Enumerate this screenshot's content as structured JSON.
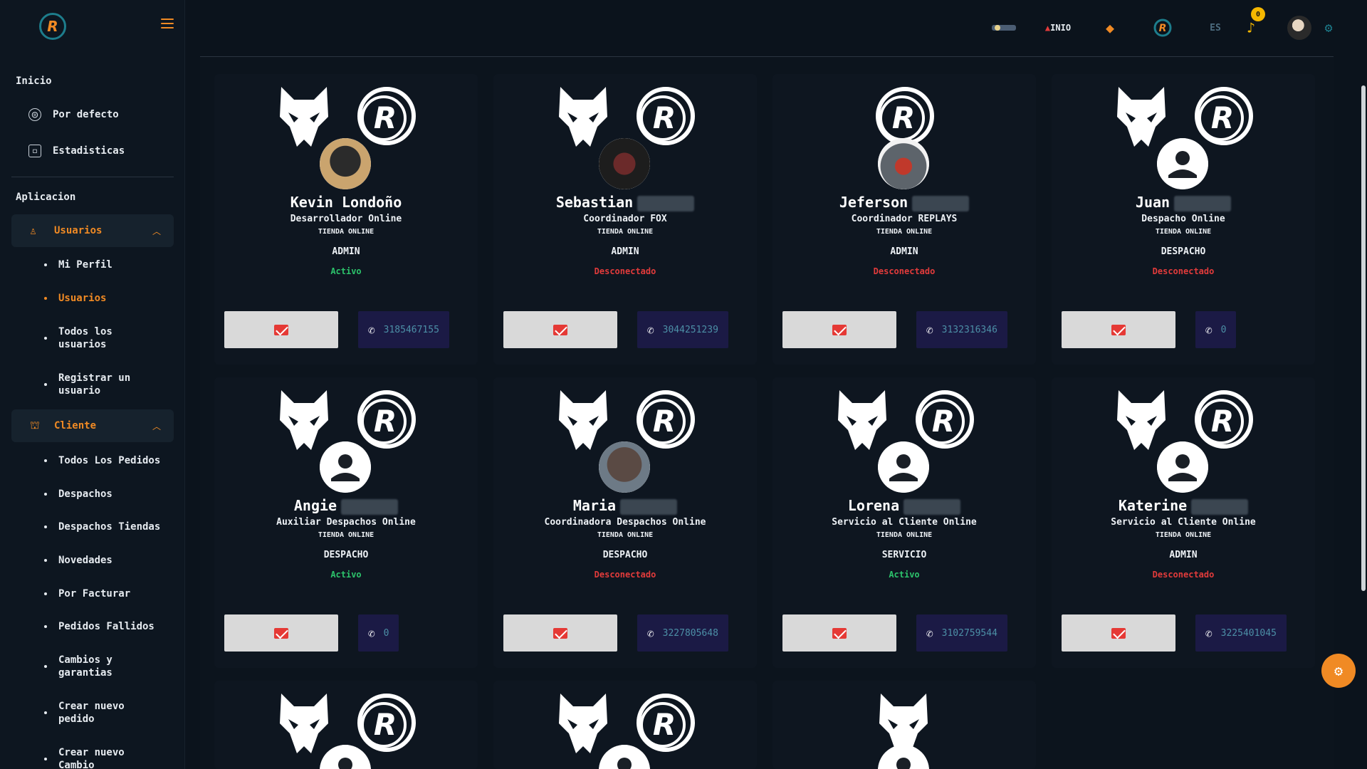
{
  "sidebar": {
    "heading_inicio": "Inicio",
    "link_default": "Por defecto",
    "link_stats": "Estadisticas",
    "heading_app": "Aplicacion",
    "group_users": "Usuarios",
    "users_items": [
      "Mi Perfil",
      "Usuarios",
      "Todos los usuarios",
      "Registrar un usuario"
    ],
    "group_client": "Cliente",
    "client_items": [
      "Todos Los Pedidos",
      "Despachos",
      "Despachos Tiendas",
      "Novedades",
      "Por Facturar",
      "Pedidos Fallidos",
      "Cambios y garantias",
      "Crear nuevo pedido",
      "Crear nuevo Cambio"
    ]
  },
  "header": {
    "lang": "ES",
    "notifications": "0",
    "brand_label": "INIO"
  },
  "cards": [
    {
      "first": "Kevin Londoño",
      "role": "Desarrollador Online",
      "store": "TIENDA ONLINE",
      "level": "ADMIN",
      "status": "Activo",
      "phone": "3185467155"
    },
    {
      "first": "Sebastian",
      "role": "Coordinador FOX",
      "store": "TIENDA ONLINE",
      "level": "ADMIN",
      "status": "Desconectado",
      "phone": "3044251239"
    },
    {
      "first": "Jeferson",
      "role": "Coordinador REPLAYS",
      "store": "TIENDA ONLINE",
      "level": "ADMIN",
      "status": "Desconectado",
      "phone": "3132316346"
    },
    {
      "first": "Juan",
      "role": "Despacho Online",
      "store": "TIENDA ONLINE",
      "level": "DESPACHO",
      "status": "Desconectado",
      "phone": "0"
    },
    {
      "first": "Angie",
      "role": "Auxiliar Despachos Online",
      "store": "TIENDA ONLINE",
      "level": "DESPACHO",
      "status": "Activo",
      "phone": "0"
    },
    {
      "first": "Maria",
      "role": "Coordinadora Despachos Online",
      "store": "TIENDA ONLINE",
      "level": "DESPACHO",
      "status": "Desconectado",
      "phone": "3227805648"
    },
    {
      "first": "Lorena",
      "role": "Servicio al Cliente Online",
      "store": "TIENDA ONLINE",
      "level": "SERVICIO",
      "status": "Activo",
      "phone": "3102759544"
    },
    {
      "first": "Katerine",
      "role": "Servicio al Cliente Online",
      "store": "TIENDA ONLINE",
      "level": "ADMIN",
      "status": "Desconectado",
      "phone": "3225401045"
    }
  ],
  "colors": {
    "accent": "#f08a24",
    "active": "#2cc36b",
    "offline": "#e23b3b"
  }
}
